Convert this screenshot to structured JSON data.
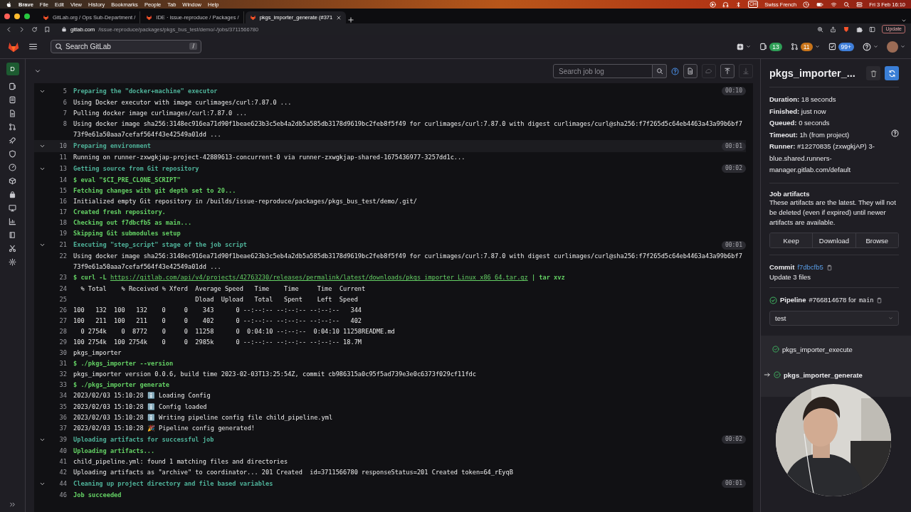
{
  "menubar": {
    "app": "Brave",
    "menus": [
      "File",
      "Edit",
      "View",
      "History",
      "Bookmarks",
      "People",
      "Tab",
      "Window",
      "Help"
    ],
    "keyboard_badge": "CH",
    "keyboard": "Swiss French",
    "clock": "Fri 3 Feb 16:10"
  },
  "browser": {
    "tabs": [
      {
        "title": "GitLab.org / Ops Sub-Department /",
        "selected": false
      },
      {
        "title": "IDE · issue-reproduce / Packages /",
        "selected": false
      },
      {
        "title": "pkgs_importer_generate (#371",
        "selected": true
      }
    ],
    "url_host": "gitlab.com",
    "url_path": "/issue-reproduce/packages/pkgs_bus_test/demo/-/jobs/3711566780",
    "update_button": "Update"
  },
  "header": {
    "search_placeholder": "Search GitLab",
    "search_shortcut": "/",
    "counters": [
      {
        "kind": "issues",
        "count": "13",
        "color": "#2f9e57"
      },
      {
        "kind": "merge_requests",
        "count": "11",
        "color": "#c8741a"
      },
      {
        "kind": "todos",
        "count": "99+",
        "color": "#3f7ed8"
      }
    ]
  },
  "nav": {
    "group_avatar": "D"
  },
  "log_toolbar": {
    "search_placeholder": "Search job log",
    "buttons": [
      {
        "kind": "raw",
        "disabled": false
      },
      {
        "kind": "erase",
        "disabled": true
      },
      {
        "kind": "top",
        "disabled": false
      },
      {
        "kind": "bottom",
        "disabled": true
      }
    ]
  },
  "log": {
    "lines": [
      {
        "number": "5",
        "kind": "section",
        "text": "Preparing the \"docker+machine\" executor",
        "expanded": true,
        "duration": "00:10",
        "highlighted": false
      },
      {
        "number": "6",
        "kind": "output",
        "text": "Using Docker executor with image curlimages/curl:7.87.0 ..."
      },
      {
        "number": "7",
        "kind": "output",
        "text": "Pulling docker image curlimages/curl:7.87.0 ..."
      },
      {
        "number": "8",
        "kind": "output",
        "text": "Using docker image sha256:3148ec916ea71d90f1beae623b3c5eb4a2db5a585db3178d9619bc2feb8f5f49 for curlimages/curl:7.87.0 with digest curlimages/curl@sha256:f7f265d5c64eb4463a43a99b6bf773f9e61a50aaa7cefaf564f43e42549a01dd ..."
      },
      {
        "number": "10",
        "kind": "section",
        "text": "Preparing environment",
        "expanded": true,
        "duration": "00:01",
        "highlighted": true
      },
      {
        "number": "11",
        "kind": "output",
        "text": "Running on runner-zxwgkjap-project-42889613-concurrent-0 via runner-zxwgkjap-shared-1675436977-3257dd1c..."
      },
      {
        "number": "13",
        "kind": "section",
        "text": "Getting source from Git repository",
        "expanded": true,
        "duration": "00:02",
        "highlighted": false
      },
      {
        "number": "14",
        "kind": "command",
        "text": "$ eval \"$CI_PRE_CLONE_SCRIPT\""
      },
      {
        "number": "15",
        "kind": "command",
        "text": "Fetching changes with git depth set to 20..."
      },
      {
        "number": "16",
        "kind": "output",
        "text": "Initialized empty Git repository in /builds/issue-reproduce/packages/pkgs_bus_test/demo/.git/"
      },
      {
        "number": "17",
        "kind": "command",
        "text": "Created fresh repository."
      },
      {
        "number": "18",
        "kind": "command",
        "text": "Checking out f7dbcfb5 as main..."
      },
      {
        "number": "19",
        "kind": "command",
        "text": "Skipping Git submodules setup"
      },
      {
        "number": "21",
        "kind": "section",
        "text": "Executing \"step_script\" stage of the job script",
        "expanded": true,
        "duration": "00:01",
        "highlighted": false
      },
      {
        "number": "22",
        "kind": "output",
        "text": "Using docker image sha256:3148ec916ea71d90f1beae623b3c5eb4a2db5a585db3178d9619bc2feb8f5f49 for curlimages/curl:7.87.0 with digest curlimages/curl@sha256:f7f265d5c64eb4463a43a99b6bf773f9e61a50aaa7cefaf564f43e42549a01dd ..."
      },
      {
        "number": "23",
        "kind": "command",
        "text": "$ curl -L ",
        "link": "https://gitlab.com/api/v4/projects/42763230/releases/permalink/latest/downloads/pkgs_importer_Linux_x86_64.tar.gz",
        "suffix": " | tar xvz"
      },
      {
        "number": "24",
        "kind": "output",
        "text": "  % Total    % Received % Xferd  Average Speed   Time    Time     Time  Current"
      },
      {
        "number": "25",
        "kind": "output",
        "text": "                                 Dload  Upload   Total   Spent    Left  Speed"
      },
      {
        "number": "26",
        "kind": "output",
        "text": "100   132  100   132    0     0    343      0 --:--:-- --:--:-- --:--:--   344"
      },
      {
        "number": "27",
        "kind": "output",
        "text": "100   211  100   211    0     0    402      0 --:--:-- --:--:-- --:--:--   402"
      },
      {
        "number": "28",
        "kind": "output",
        "text": "  0 2754k    0  8772    0     0  11258      0  0:04:10 --:--:--  0:04:10 11258README.md"
      },
      {
        "number": "29",
        "kind": "output",
        "text": "100 2754k  100 2754k    0     0  2985k      0 --:--:-- --:--:-- --:--:-- 18.7M"
      },
      {
        "number": "30",
        "kind": "output",
        "text": "pkgs_importer"
      },
      {
        "number": "31",
        "kind": "command",
        "text": "$ ./pkgs_importer --version"
      },
      {
        "number": "32",
        "kind": "output",
        "text": "pkgs_importer version 0.0.6, build time 2023-02-03T13:25:54Z, commit cb986315a0c95f5ad739e3e0c6373f029cf11fdc"
      },
      {
        "number": "33",
        "kind": "command",
        "text": "$ ./pkgs_importer generate"
      },
      {
        "number": "34",
        "kind": "output",
        "text": "2023/02/03 15:10:28 ℹ️ Loading Config"
      },
      {
        "number": "35",
        "kind": "output",
        "text": "2023/02/03 15:10:28 ℹ️ Config loaded"
      },
      {
        "number": "36",
        "kind": "output",
        "text": "2023/02/03 15:10:28 ℹ️ Writing pipeline config file child_pipeline.yml"
      },
      {
        "number": "37",
        "kind": "output",
        "text": "2023/02/03 15:10:28 🎉 Pipeline config generated!"
      },
      {
        "number": "39",
        "kind": "section",
        "text": "Uploading artifacts for successful job",
        "expanded": true,
        "duration": "00:02",
        "highlighted": false
      },
      {
        "number": "40",
        "kind": "command",
        "text": "Uploading artifacts..."
      },
      {
        "number": "41",
        "kind": "output",
        "text": "child_pipeline.yml: found 1 matching files and directories"
      },
      {
        "number": "42",
        "kind": "output",
        "text": "Uploading artifacts as \"archive\" to coordinator... 201 Created  id=3711566780 responseStatus=201 Created token=64_rEyqB"
      },
      {
        "number": "44",
        "kind": "section",
        "text": "Cleaning up project directory and file based variables",
        "expanded": true,
        "duration": "00:01",
        "highlighted": false
      },
      {
        "number": "46",
        "kind": "command",
        "text": "Job succeeded"
      }
    ]
  },
  "sidebar": {
    "title": "pkgs_importer_...",
    "details": [
      {
        "text": "**Duration:** 18 seconds",
        "help": false
      },
      {
        "text": "**Finished:** just now",
        "help": false
      },
      {
        "text": "**Queued:** 0 seconds",
        "help": false
      },
      {
        "text": "**Timeout:** 1h (from project)",
        "help": true
      },
      {
        "text": "**Runner:** #12270835 (zxwgkjAP) 3-blue.shared.runners-manager.gitlab.com/default",
        "help": false
      }
    ],
    "artifacts": {
      "heading": "Job artifacts",
      "note": "These artifacts are the latest. They will not be deleted (even if expired) until newer artifacts are available.",
      "buttons": [
        "Keep",
        "Download",
        "Browse"
      ]
    },
    "commit": {
      "label": "Commit",
      "sha": "f7dbcfb5",
      "message": "Update 3 files"
    },
    "pipeline": {
      "label": "Pipeline",
      "id": "#766814678 for",
      "ref": "main"
    },
    "stage": "test",
    "jobs": [
      {
        "name": "pkgs_importer_execute",
        "selected": false
      },
      {
        "name": "pkgs_importer_generate",
        "selected": true
      }
    ]
  }
}
